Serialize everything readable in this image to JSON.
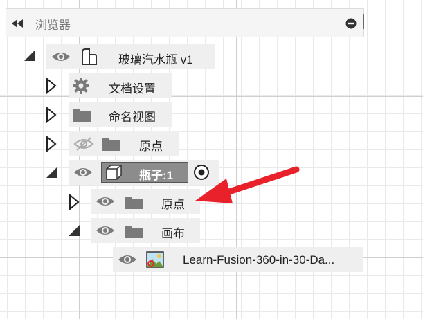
{
  "browser": {
    "title": "浏览器",
    "icons": {
      "collapse": "double-left-arrow-icon",
      "pin": "minus-circle-icon"
    }
  },
  "tree": {
    "root": {
      "label": "玻璃汽水瓶 v1",
      "visible": true,
      "expanded": true
    },
    "doc_settings": {
      "label": "文档设置",
      "icon": "gear-icon"
    },
    "named_views": {
      "label": "命名视图",
      "icon": "folder-icon"
    },
    "origin": {
      "label": "原点",
      "hidden": true,
      "icon": "folder-icon"
    },
    "bottle": {
      "label": "瓶子:1",
      "expanded": true,
      "active": true
    },
    "bottle_origin": {
      "label": "原点",
      "icon": "folder-icon"
    },
    "canvas": {
      "label": "画布",
      "icon": "folder-icon",
      "expanded": true
    },
    "canvas_image": {
      "label": "Learn-Fusion-360-in-30-Da...",
      "icon": "image-icon"
    }
  },
  "colors": {
    "arrow": "#e8212b",
    "icon_gray": "#7a7a7a",
    "row_bg": "#efefef",
    "active_tag": "#8c8c8c"
  }
}
